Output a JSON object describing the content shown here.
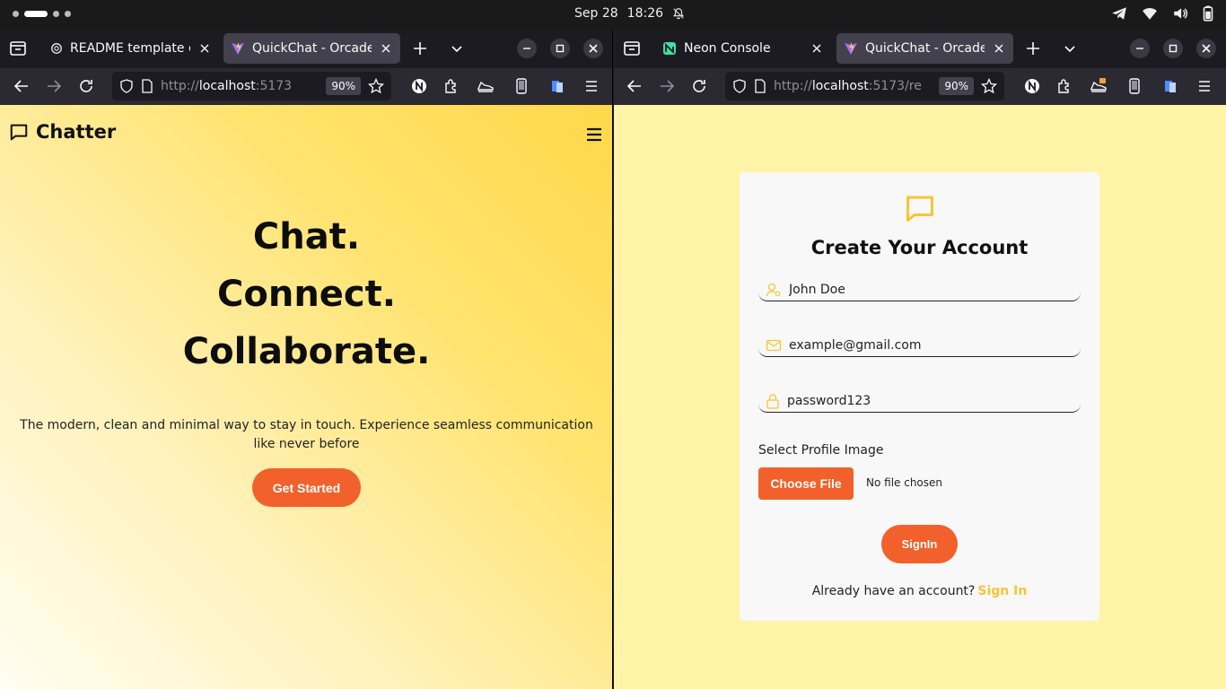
{
  "system": {
    "date": "Sep 28",
    "time": "18:26"
  },
  "left_window": {
    "tabs": [
      {
        "title": "README template cre",
        "icon": "chatgpt-icon",
        "active": false
      },
      {
        "title": "QuickChat - Orcadev",
        "icon": "vite-icon",
        "active": true
      }
    ],
    "url_prefix": "http://",
    "url_host": "localhost",
    "url_rest": ":5173",
    "zoom": "90%",
    "page": {
      "brand": "Chatter",
      "hero_line1": "Chat.",
      "hero_line2": "Connect.",
      "hero_line3": "Collaborate.",
      "tagline": "The modern, clean and minimal way to stay in touch. Experience seamless communication like never before",
      "cta": "Get Started"
    }
  },
  "right_window": {
    "tabs": [
      {
        "title": "Neon Console",
        "icon": "neon-icon",
        "active": false
      },
      {
        "title": "QuickChat - Orcadev",
        "icon": "vite-icon",
        "active": true
      }
    ],
    "url_prefix": "http://",
    "url_host": "localhost",
    "url_rest": ":5173/re",
    "zoom": "90%",
    "page": {
      "title": "Create Your Account",
      "name_value": "John Doe",
      "email_value": "example@gmail.com",
      "password_value": "password123",
      "file_label": "Select Profile Image",
      "file_button": "Choose File",
      "file_status": "No file chosen",
      "submit": "SignIn",
      "footer_text": "Already have an account?",
      "footer_link": "Sign In"
    }
  },
  "colors": {
    "accent_orange": "#f2602b",
    "accent_yellow": "#f8c534",
    "browser_chrome": "#2b2a33"
  }
}
